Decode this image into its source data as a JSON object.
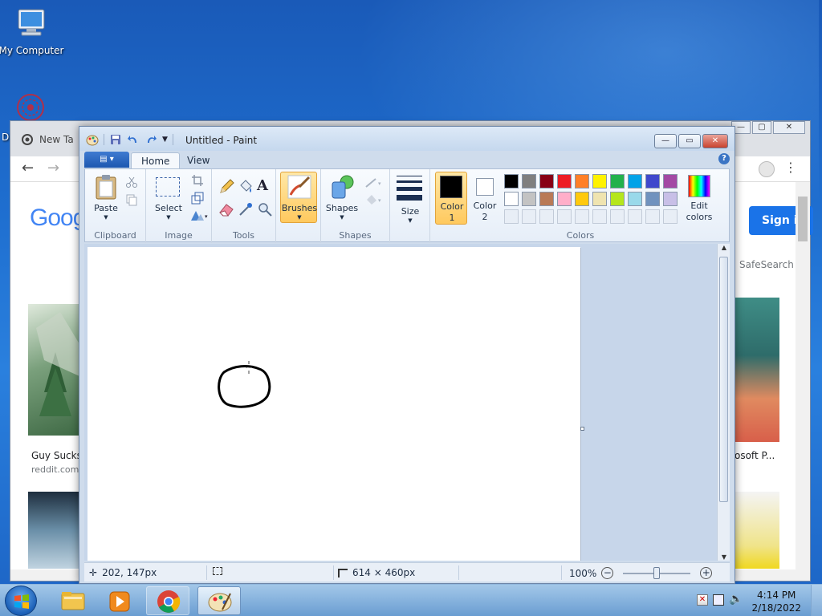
{
  "desktop": {
    "icon_my_computer": "My Computer",
    "icon_partial_letter": "D"
  },
  "chrome": {
    "tab_title": "New Ta",
    "sign_in": "Sign in",
    "safesearch": "SafeSearch",
    "google_partial": "Goog",
    "result_left_title": "Guy Sucks",
    "result_left_source": "reddit.com",
    "result_right_title": "osoft P..."
  },
  "paint": {
    "window_title": "Untitled - Paint",
    "tabs": {
      "home": "Home",
      "view": "View"
    },
    "ribbon": {
      "clipboard": {
        "group_label": "Clipboard",
        "paste": "Paste"
      },
      "image": {
        "group_label": "Image",
        "select": "Select"
      },
      "tools": {
        "group_label": "Tools"
      },
      "brushes": {
        "label": "Brushes"
      },
      "shapes": {
        "group_label": "Shapes",
        "label": "Shapes"
      },
      "size": {
        "label": "Size"
      },
      "colors": {
        "group_label": "Colors",
        "color1_line1": "Color",
        "color1_line2": "1",
        "color2_line1": "Color",
        "color2_line2": "2",
        "edit_line1": "Edit",
        "edit_line2": "colors"
      }
    },
    "palette_row1": [
      "#000000",
      "#7f7f7f",
      "#880015",
      "#ed1c24",
      "#ff7f27",
      "#fff200",
      "#22b14c",
      "#00a2e8",
      "#3f48cc",
      "#a349a4"
    ],
    "palette_row2": [
      "#ffffff",
      "#c3c3c3",
      "#b97a57",
      "#ffaec9",
      "#ffc90e",
      "#efe4b0",
      "#b5e61d",
      "#99d9ea",
      "#7092be",
      "#c8bfe7"
    ],
    "status": {
      "cursor_pos": "202, 147px",
      "canvas_size": "614 × 460px",
      "zoom": "100%"
    }
  },
  "taskbar": {
    "time": "4:14 PM",
    "date": "2/18/2022"
  }
}
